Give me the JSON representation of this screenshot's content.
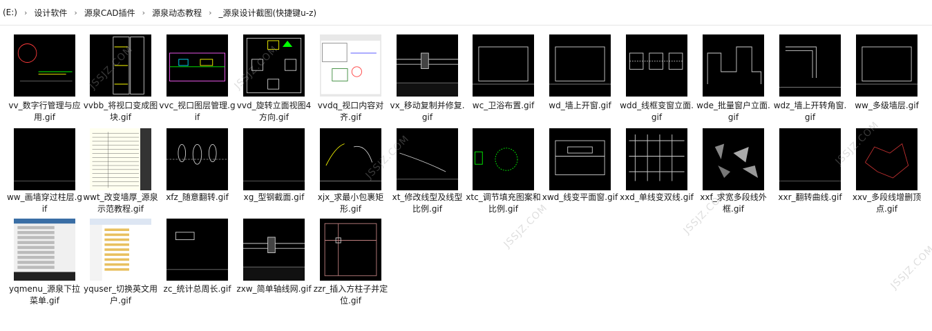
{
  "breadcrumb": [
    "(E:)",
    "设计软件",
    "源泉CAD插件",
    "源泉动态教程",
    "_源泉设计截图(快捷键u-z)"
  ],
  "watermark": "JSSJZ.COM",
  "files": [
    {
      "name": "vv_数字行管理与应用.gif",
      "kind": "lines-green"
    },
    {
      "name": "vvbb_将视口变成图块.gif",
      "kind": "tall-doc"
    },
    {
      "name": "vvc_视口图层管理.gif",
      "kind": "plan-color"
    },
    {
      "name": "vvd_旋转立面视图4方向.gif",
      "kind": "room"
    },
    {
      "name": "vvdq_视口内容对齐.gif",
      "kind": "window-ui"
    },
    {
      "name": "vx_移动复制并修复.gif",
      "kind": "rect-lines"
    },
    {
      "name": "wc_卫浴布置.gif",
      "kind": "rect-frame"
    },
    {
      "name": "wd_墙上开窗.gif",
      "kind": "rect-frame"
    },
    {
      "name": "wdd_线框变窗立面.gif",
      "kind": "windows"
    },
    {
      "name": "wde_批量窗户立面.gif",
      "kind": "steps"
    },
    {
      "name": "wdz_墙上开转角窗.gif",
      "kind": "corner"
    },
    {
      "name": "ww_多级墙层.gif",
      "kind": "rect-frame"
    },
    {
      "name": "ww_画墙穿过柱层.gif",
      "kind": "blank"
    },
    {
      "name": "wwt_改变墙厚_源泉示范教程.gif",
      "kind": "table"
    },
    {
      "name": "xfz_随意翻转.gif",
      "kind": "figures"
    },
    {
      "name": "xg_型钢截面.gif",
      "kind": "blank"
    },
    {
      "name": "xjx_求最小包裹矩形.gif",
      "kind": "arcs"
    },
    {
      "name": "xt_修改线型及线型比例.gif",
      "kind": "curve"
    },
    {
      "name": "xtc_调节填充图案和比例.gif",
      "kind": "circle"
    },
    {
      "name": "xwd_线变平面窗.gif",
      "kind": "window-plan"
    },
    {
      "name": "xxd_单线变双线.gif",
      "kind": "grid-lines"
    },
    {
      "name": "xxf_求宽多段线外框.gif",
      "kind": "shapes"
    },
    {
      "name": "xxr_翻转曲线.gif",
      "kind": "blank"
    },
    {
      "name": "xxv_多段线增删顶点.gif",
      "kind": "red-shape"
    },
    {
      "name": "yqmenu_源泉下拉菜单.gif",
      "kind": "menu"
    },
    {
      "name": "yquser_切换英文用户.gif",
      "kind": "explorer"
    },
    {
      "name": "zc_统计总周长.gif",
      "kind": "small-rect"
    },
    {
      "name": "zxw_简单轴线网.gif",
      "kind": "rect-lines"
    },
    {
      "name": "zzr_插入方柱子并定位.gif",
      "kind": "columns"
    }
  ]
}
